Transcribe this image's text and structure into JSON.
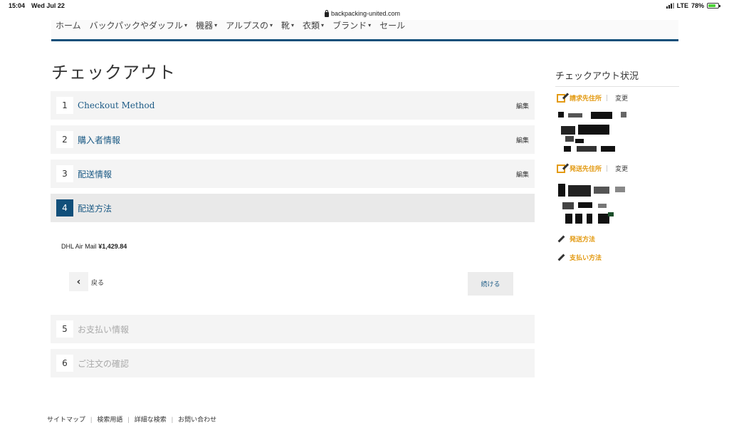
{
  "status_bar": {
    "time": "15:04",
    "date": "Wed Jul 22",
    "url": "backpacking-united.com",
    "network": "LTE",
    "battery": "78%"
  },
  "nav": {
    "items": [
      {
        "label": "ホーム",
        "dropdown": false
      },
      {
        "label": "バックパックやダッフル",
        "dropdown": true
      },
      {
        "label": "機器",
        "dropdown": true
      },
      {
        "label": "アルプスの",
        "dropdown": true
      },
      {
        "label": "靴",
        "dropdown": true
      },
      {
        "label": "衣類",
        "dropdown": true
      },
      {
        "label": "ブランド",
        "dropdown": true
      },
      {
        "label": "セール",
        "dropdown": false
      }
    ]
  },
  "page_title": "チェックアウト",
  "steps": [
    {
      "num": "1",
      "label": "Checkout Method",
      "edit": "編集"
    },
    {
      "num": "2",
      "label": "購入者情報",
      "edit": "編集"
    },
    {
      "num": "3",
      "label": "配送情報",
      "edit": "編集"
    },
    {
      "num": "4",
      "label": "配送方法",
      "edit": ""
    },
    {
      "num": "5",
      "label": "お支払い情報",
      "edit": ""
    },
    {
      "num": "6",
      "label": "ご注文の確認",
      "edit": ""
    }
  ],
  "shipping": {
    "method": "DHL Air Mail",
    "price": "¥1,429.84"
  },
  "buttons": {
    "back_arrow": "‹",
    "back": "戻る",
    "continue": "続ける"
  },
  "sidebar": {
    "title": "チェックアウト状況",
    "billing_label": "請求先住所",
    "billing_change": "変更",
    "shipping_label": "発送先住所",
    "shipping_change": "変更",
    "shipping_method_label": "発送方法",
    "payment_label": "支払い方法",
    "accent_color": "#e39a12"
  },
  "footer": {
    "links": [
      "サイトマップ",
      "検索用語",
      "詳細な検索",
      "お問い合わせ"
    ]
  }
}
